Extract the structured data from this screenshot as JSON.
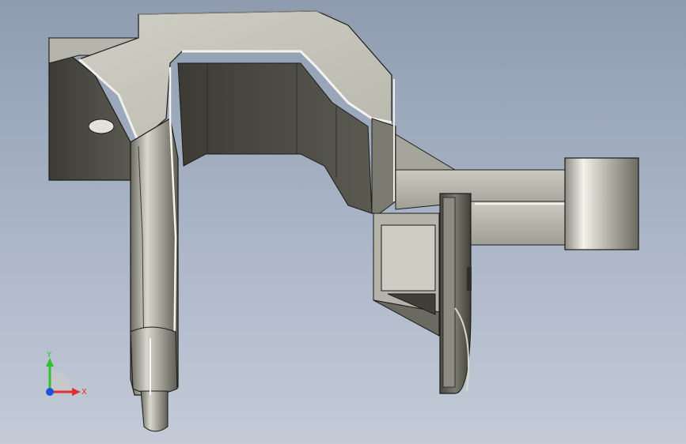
{
  "viewport": {
    "background_top": "#8f9cb0",
    "background_bottom": "#c4cbd7"
  },
  "model": {
    "icon": "cad-bracket-part",
    "face_light": "#c7c7bd",
    "face_mid": "#9e9e94",
    "face_dark": "#4a4a42",
    "edge": "#1c1c18"
  },
  "triad": {
    "x_label": "X",
    "y_label": "Y",
    "x_color": "#e03030",
    "y_color": "#30c030",
    "z_color": "#2050e0"
  }
}
